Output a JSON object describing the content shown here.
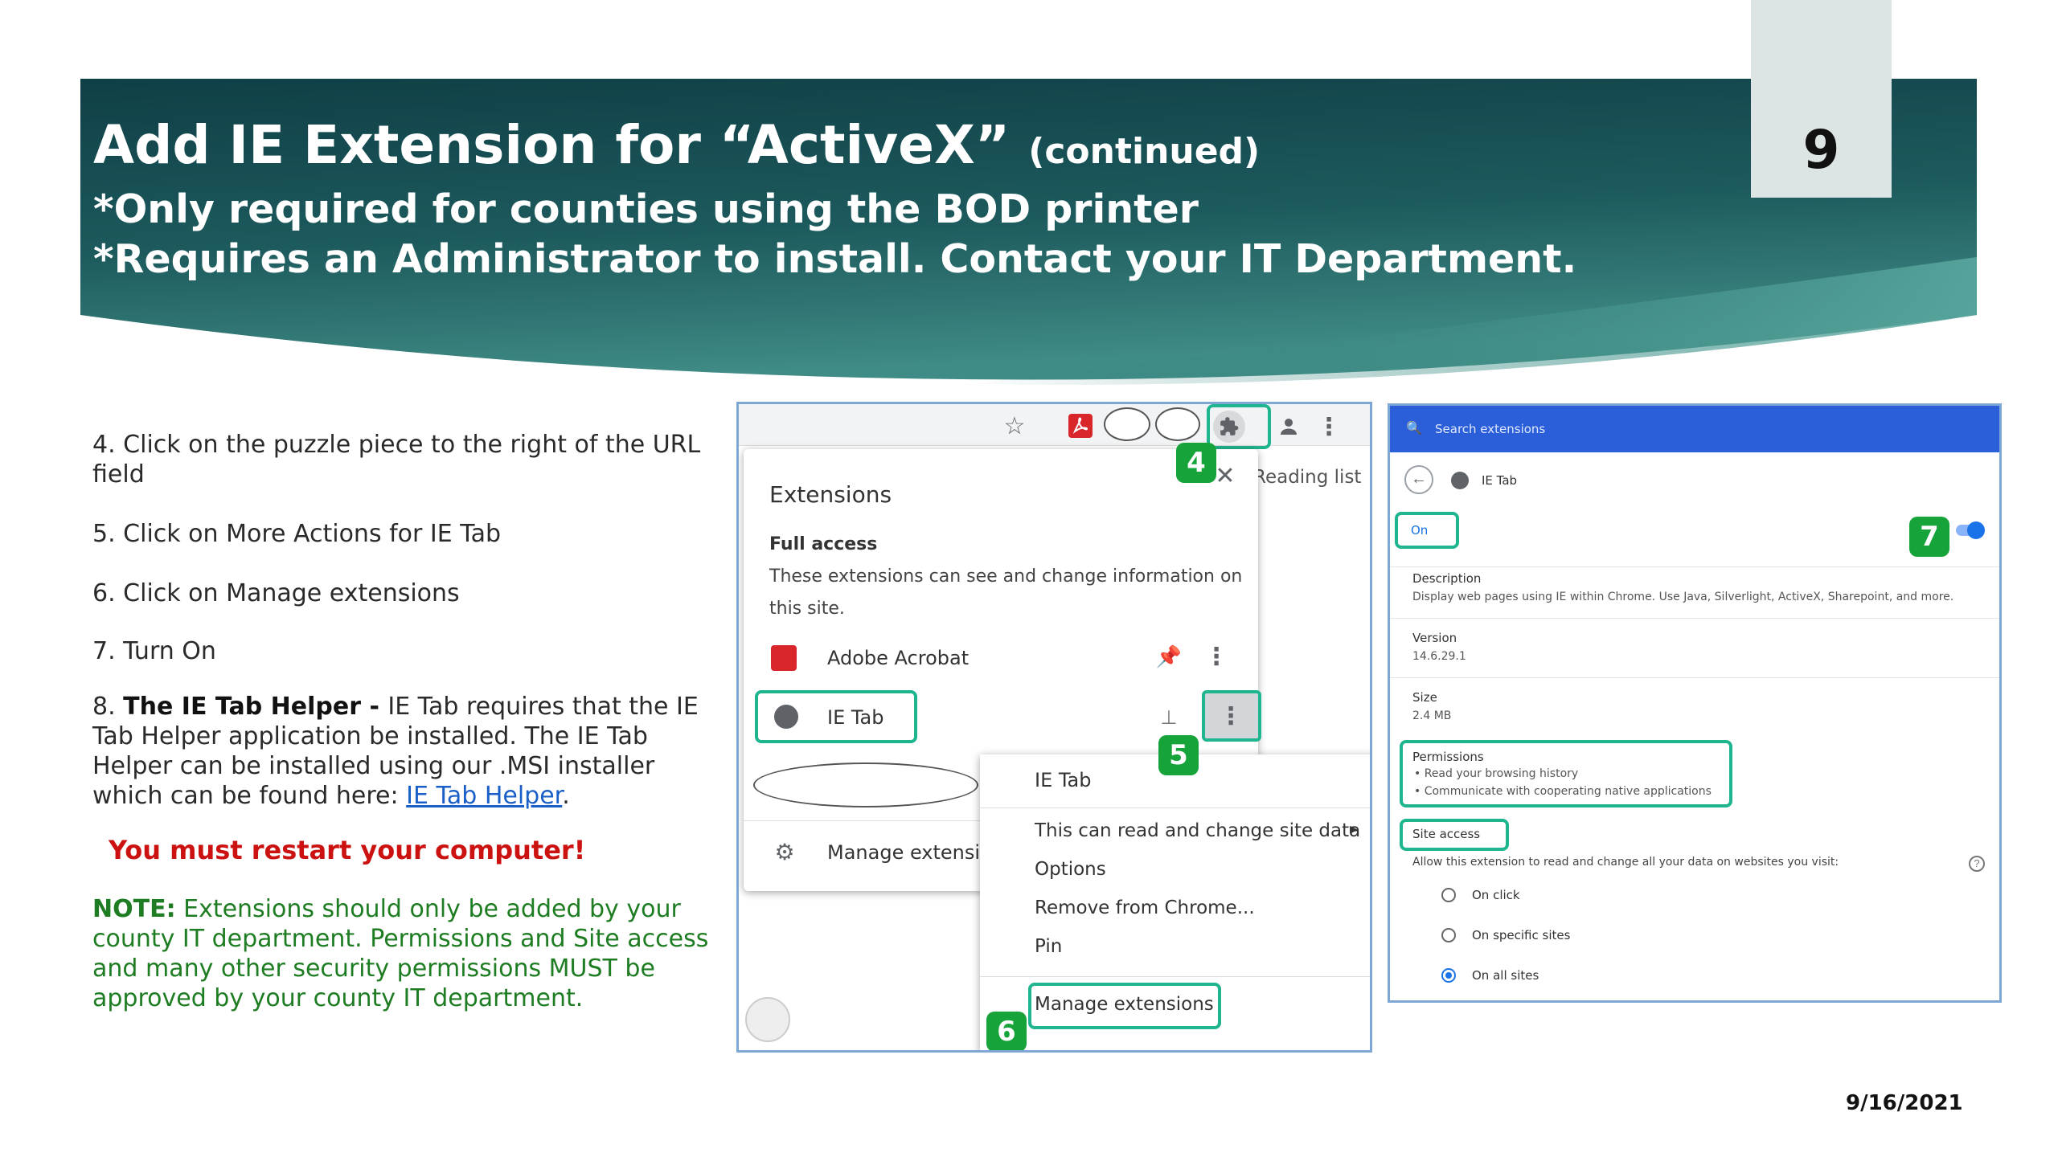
{
  "header": {
    "title": "Add IE Extension for  “ActiveX”",
    "title_suffix": "(continued)",
    "line2": "*Only required for counties using the BOD printer",
    "line3": "*Requires an Administrator to install. Contact your IT Department.",
    "page_number": "9"
  },
  "steps": {
    "s4": "4. Click on the puzzle piece to the right of the URL field",
    "s5": "5. Click on More Actions for IE Tab",
    "s6": "6. Click on Manage extensions",
    "s7": "7. Turn On",
    "s8_prefix": "8. ",
    "s8_bold": "The IE Tab Helper - ",
    "s8_text": "IE Tab requires that the IE Tab Helper application be installed. The IE Tab Helper can be installed using our .MSI installer which can be found here: ",
    "s8_link": "IE Tab Helper",
    "s8_end": ".",
    "warning": "You must restart your computer!",
    "note_label": "NOTE:",
    "note_text": "  Extensions should only be added by your county IT department. Permissions and Site access and many other security permissions MUST be approved by your county IT department."
  },
  "panel1": {
    "reading_list": "Reading list",
    "extensions_title": "Extensions",
    "full_access": "Full access",
    "full_access_desc1": "These extensions can see and change information on",
    "full_access_desc2": "this site.",
    "ext1": "Adobe Acrobat",
    "ext2": "IE Tab",
    "manage": "Manage extensions",
    "menu_title": "IE Tab",
    "menu_item1": "This can read and change site data",
    "menu_item2": "Options",
    "menu_item3": "Remove from Chrome...",
    "menu_item4": "Pin",
    "menu_item5": "Manage extensions",
    "badges": [
      "4",
      "5",
      "6"
    ],
    "accent_red": "#d8262b",
    "pin_blue": "#1a73e8"
  },
  "panel2": {
    "search_placeholder": "Search extensions",
    "ext_name": "IE Tab",
    "on_label": "On",
    "badge": "7",
    "description_label": "Description",
    "description_text": "Display web pages using IE within Chrome. Use Java, Silverlight, ActiveX, Sharepoint, and more.",
    "version_label": "Version",
    "version_value": "14.6.29.1",
    "size_label": "Size",
    "size_value": "2.4 MB",
    "permissions_label": "Permissions",
    "perm1": "Read your browsing history",
    "perm2": "Communicate with cooperating native applications",
    "site_access_label": "Site access",
    "site_access_text": "Allow this extension to read and change all your data on websites you visit:",
    "opt1": "On click",
    "opt2": "On specific sites",
    "opt3": "On all sites",
    "selected_option": "On all sites",
    "header_color": "#2b5fd9"
  },
  "footer": {
    "date": "9/16/2021"
  },
  "colors": {
    "banner_dark": "#14474e",
    "banner_light": "#3e8a84",
    "green": "#16a33a",
    "teal_box": "#1fb58f"
  }
}
